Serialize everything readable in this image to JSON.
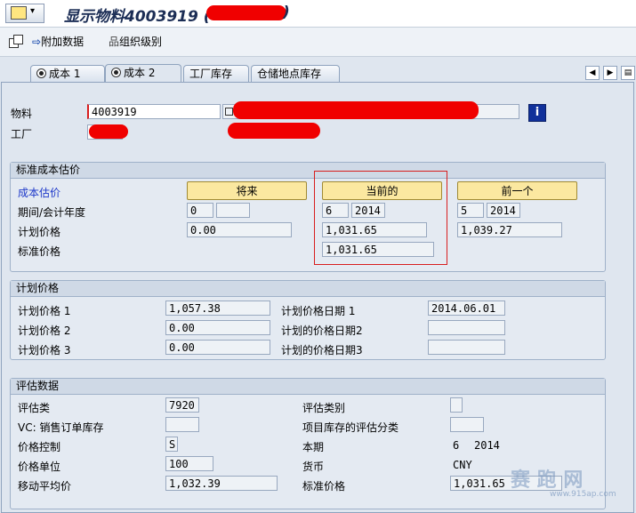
{
  "title": "显示物料4003919 (",
  "toolbar": {
    "additional_data": "附加数据",
    "org_levels": "组织级别"
  },
  "tabs": [
    "成本 1",
    "成本 2",
    "工厂库存",
    "仓储地点库存"
  ],
  "header": {
    "material_label": "物料",
    "material_value": "4003919",
    "plant_label": "工厂"
  },
  "std_cost": {
    "group_title": "标准成本估价",
    "cost_estimate_label": "成本估价",
    "future_button": "将来",
    "current_button": "当前的",
    "previous_button": "前一个",
    "period_label": "期间/会计年度",
    "planned_price_label": "计划价格",
    "standard_price_label": "标准价格",
    "future_period": "0",
    "future_year": "",
    "future_planned_price": "0.00",
    "current_period": "6",
    "current_year": "2014",
    "current_planned_price": "1,031.65",
    "current_standard_price": "1,031.65",
    "previous_period": "5",
    "previous_year": "2014",
    "previous_planned_price": "1,039.27"
  },
  "planned_prices": {
    "group_title": "计划价格",
    "price1_label": "计划价格 1",
    "price1": "1,057.38",
    "price2_label": "计划价格 2",
    "price2": "0.00",
    "price3_label": "计划价格 3",
    "price3": "0.00",
    "date1_label": "计划价格日期 1",
    "date1": "2014.06.01",
    "date2_label": "计划的价格日期2",
    "date2": "",
    "date3_label": "计划的价格日期3",
    "date3": ""
  },
  "valuation": {
    "group_title": "评估数据",
    "val_class_label": "评估类",
    "val_class": "7920",
    "vc_label": "VC: 销售订单库存",
    "vc": "",
    "price_control_label": "价格控制",
    "price_control": "S",
    "price_unit_label": "价格单位",
    "price_unit": "100",
    "moving_avg_label": "移动平均价",
    "moving_avg": "1,032.39",
    "val_category_label": "评估类别",
    "val_category": "",
    "proj_stock_label": "项目库存的评估分类",
    "proj_stock": "",
    "current_period_label": "本期",
    "current_period": "6",
    "current_year": "2014",
    "currency_label": "货币",
    "currency": "CNY",
    "standard_price_label": "标准价格",
    "standard_price": "1,031.65"
  },
  "watermark": {
    "main": "赛 跑 网",
    "sub": "www.915ap.com"
  },
  "colors": {
    "highlight_box": "#d81e1e",
    "redaction": "#f00000",
    "button_yellow": "#fbe8a0"
  }
}
